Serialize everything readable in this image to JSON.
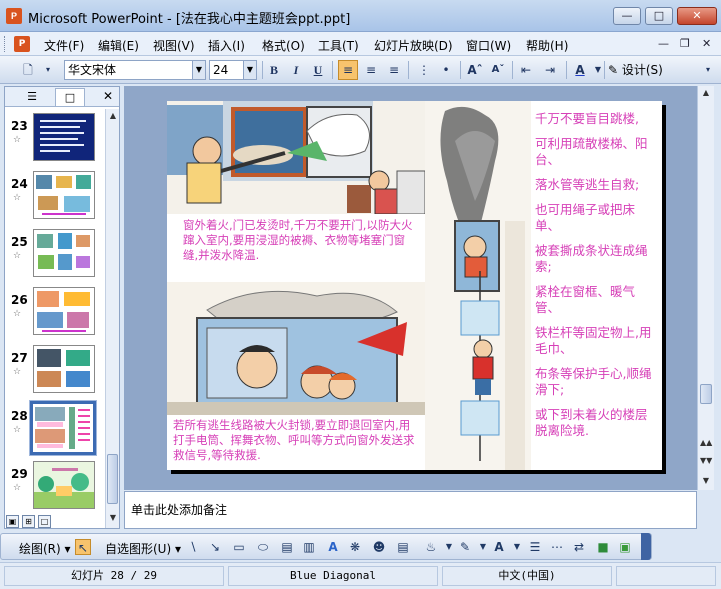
{
  "window": {
    "title": "Microsoft PowerPoint - [法在我心中主题班会ppt.ppt]",
    "app_icon_text": "P"
  },
  "menu": {
    "items": [
      "文件(F)",
      "编辑(E)",
      "视图(V)",
      "插入(I)",
      "格式(O)",
      "工具(T)",
      "幻灯片放映(D)",
      "窗口(W)",
      "帮助(H)"
    ]
  },
  "toolbar": {
    "font_name": "华文宋体",
    "font_size": "24",
    "bold": "B",
    "italic": "I",
    "underline": "U",
    "design_label": "设计(S)"
  },
  "slides_pane": {
    "thumbnails": [
      {
        "number": "23"
      },
      {
        "number": "24"
      },
      {
        "number": "25"
      },
      {
        "number": "26"
      },
      {
        "number": "27"
      },
      {
        "number": "28",
        "selected": true
      },
      {
        "number": "29"
      }
    ]
  },
  "slide": {
    "caption_top": "窗外着火,门已发烫时,千万不要开门,以防大火蹿入室内,要用浸湿的被褥、衣物等堵塞门窗缝,并泼水降温.",
    "caption_bottom": "若所有逃生线路被大火封锁,要立即退回室内,用打手电筒、挥舞衣物、呼叫等方式向窗外发送求救信号,等待救援.",
    "right_text": [
      "千万不要盲目跳楼,",
      "可利用疏散楼梯、阳台、",
      "落水管等逃生自救;",
      "也可用绳子或把床单、",
      "被套撕成条状连成绳索;",
      "紧栓在窗框、暖气管、",
      "铁栏杆等固定物上,用毛巾、",
      "布条等保护手心,顺绳滑下;",
      "或下到未着火的楼层脱离险境."
    ],
    "text_color": "#d63fb7"
  },
  "notes": {
    "placeholder": "单击此处添加备注"
  },
  "drawing_toolbar": {
    "draw_label": "绘图(R)",
    "autoshapes_label": "自选图形(U)"
  },
  "status": {
    "slide_position": "幻灯片 28 / 29",
    "design_name": "Blue Diagonal",
    "language": "中文(中国)"
  }
}
